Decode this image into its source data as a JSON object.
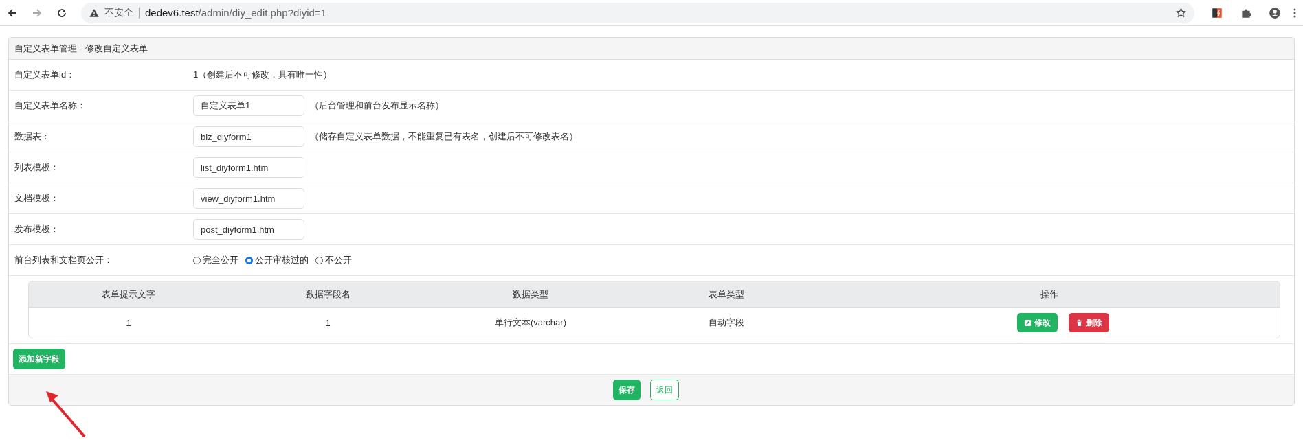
{
  "browser": {
    "security_label": "不安全",
    "url_host": "dedev6.test",
    "url_path": "/admin/diy_edit.php?diyid=1"
  },
  "panel": {
    "title": "自定义表单管理 - 修改自定义表单",
    "rows": [
      {
        "kind": "text",
        "label": "自定义表单id：",
        "value": "1（创建后不可修改，具有唯一性）"
      },
      {
        "kind": "input",
        "label": "自定义表单名称：",
        "value": "自定义表单1",
        "hint": "（后台管理和前台发布显示名称）"
      },
      {
        "kind": "input",
        "label": "数据表：",
        "value": "biz_diyform1",
        "hint": "（储存自定义表单数据，不能重复已有表名，创建后不可修改表名）"
      },
      {
        "kind": "input",
        "label": "列表模板：",
        "value": "list_diyform1.htm"
      },
      {
        "kind": "input",
        "label": "文档模板：",
        "value": "view_diyform1.htm"
      },
      {
        "kind": "input",
        "label": "发布模板：",
        "value": "post_diyform1.htm"
      },
      {
        "kind": "radio",
        "label": "前台列表和文档页公开：",
        "options": [
          {
            "label": "完全公开",
            "selected": false
          },
          {
            "label": "公开审核过的",
            "selected": true
          },
          {
            "label": "不公开",
            "selected": false
          }
        ]
      }
    ],
    "fields_table": {
      "columns": [
        "表单提示文字",
        "数据字段名",
        "数据类型",
        "表单类型",
        "操作"
      ],
      "rows": [
        {
          "cells": [
            "1",
            "1",
            "单行文本(varchar)",
            "自动字段"
          ],
          "actions": [
            {
              "kind": "edit",
              "label": "修改"
            },
            {
              "kind": "delete",
              "label": "删除"
            }
          ]
        }
      ]
    },
    "add_button": "添加新字段",
    "footer_buttons": [
      {
        "kind": "primary",
        "label": "保存"
      },
      {
        "kind": "outline",
        "label": "返回"
      }
    ]
  }
}
